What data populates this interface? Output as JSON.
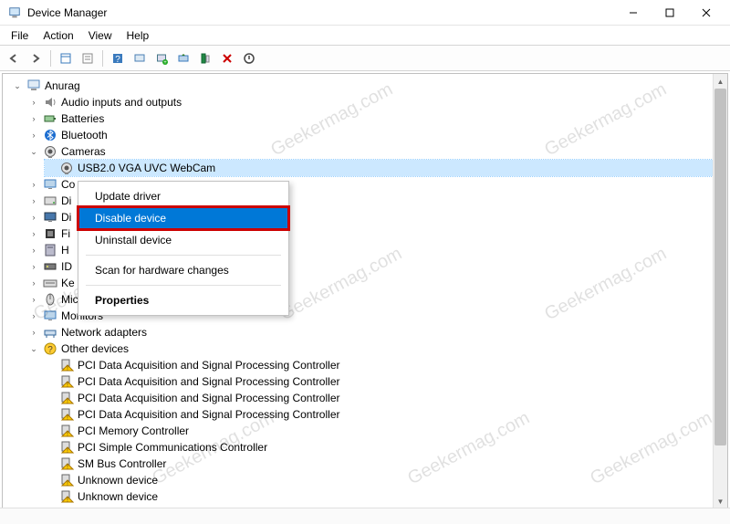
{
  "window": {
    "title": "Device Manager"
  },
  "menubar": {
    "items": [
      "File",
      "Action",
      "View",
      "Help"
    ]
  },
  "toolbar": {
    "buttons": [
      {
        "name": "back-icon"
      },
      {
        "name": "forward-icon"
      },
      {
        "name": "show-hidden-icon"
      },
      {
        "name": "properties-icon"
      },
      {
        "name": "help-icon"
      },
      {
        "name": "scan-icon"
      },
      {
        "name": "add-legacy-icon"
      },
      {
        "name": "update-driver-icon"
      },
      {
        "name": "uninstall-icon"
      },
      {
        "name": "disable-icon"
      },
      {
        "name": "enable-icon"
      }
    ]
  },
  "tree": {
    "root": {
      "label": "Anurag"
    },
    "categories": [
      {
        "label": "Audio inputs and outputs",
        "expanded": false,
        "icon": "speaker-icon"
      },
      {
        "label": "Batteries",
        "expanded": false,
        "icon": "battery-icon"
      },
      {
        "label": "Bluetooth",
        "expanded": false,
        "icon": "bluetooth-icon"
      },
      {
        "label": "Cameras",
        "expanded": true,
        "icon": "camera-icon",
        "children": [
          {
            "label": "USB2.0 VGA UVC WebCam",
            "selected": true,
            "icon": "camera-icon"
          }
        ]
      },
      {
        "label": "Co",
        "expanded": false,
        "icon": "monitor-icon"
      },
      {
        "label": "Di",
        "expanded": false,
        "icon": "disk-icon"
      },
      {
        "label": "Di",
        "expanded": false,
        "icon": "display-icon"
      },
      {
        "label": "Fi",
        "expanded": false,
        "icon": "firmware-icon"
      },
      {
        "label": "H",
        "expanded": false,
        "icon": "hid-icon"
      },
      {
        "label": "ID",
        "expanded": false,
        "icon": "ide-icon"
      },
      {
        "label": "Ke",
        "expanded": false,
        "icon": "keyboard-icon"
      },
      {
        "label": "Mice and other pointing devices",
        "expanded": false,
        "icon": "mouse-icon"
      },
      {
        "label": "Monitors",
        "expanded": false,
        "icon": "monitor-icon"
      },
      {
        "label": "Network adapters",
        "expanded": false,
        "icon": "network-icon"
      },
      {
        "label": "Other devices",
        "expanded": true,
        "icon": "question-icon",
        "children": [
          {
            "label": "PCI Data Acquisition and Signal Processing Controller",
            "icon": "warning-icon"
          },
          {
            "label": "PCI Data Acquisition and Signal Processing Controller",
            "icon": "warning-icon"
          },
          {
            "label": "PCI Data Acquisition and Signal Processing Controller",
            "icon": "warning-icon"
          },
          {
            "label": "PCI Data Acquisition and Signal Processing Controller",
            "icon": "warning-icon"
          },
          {
            "label": "PCI Memory Controller",
            "icon": "warning-icon"
          },
          {
            "label": "PCI Simple Communications Controller",
            "icon": "warning-icon"
          },
          {
            "label": "SM Bus Controller",
            "icon": "warning-icon"
          },
          {
            "label": "Unknown device",
            "icon": "warning-icon"
          },
          {
            "label": "Unknown device",
            "icon": "warning-icon"
          }
        ]
      }
    ]
  },
  "context_menu": {
    "items": [
      {
        "label": "Update driver",
        "highlight": false
      },
      {
        "label": "Disable device",
        "highlight": true
      },
      {
        "label": "Uninstall device",
        "highlight": false
      },
      {
        "sep": true
      },
      {
        "label": "Scan for hardware changes",
        "highlight": false
      },
      {
        "sep": true
      },
      {
        "label": "Properties",
        "highlight": false,
        "bold": true
      }
    ]
  },
  "watermark": "Geekermag.com",
  "statusbar": {
    "text": ""
  }
}
